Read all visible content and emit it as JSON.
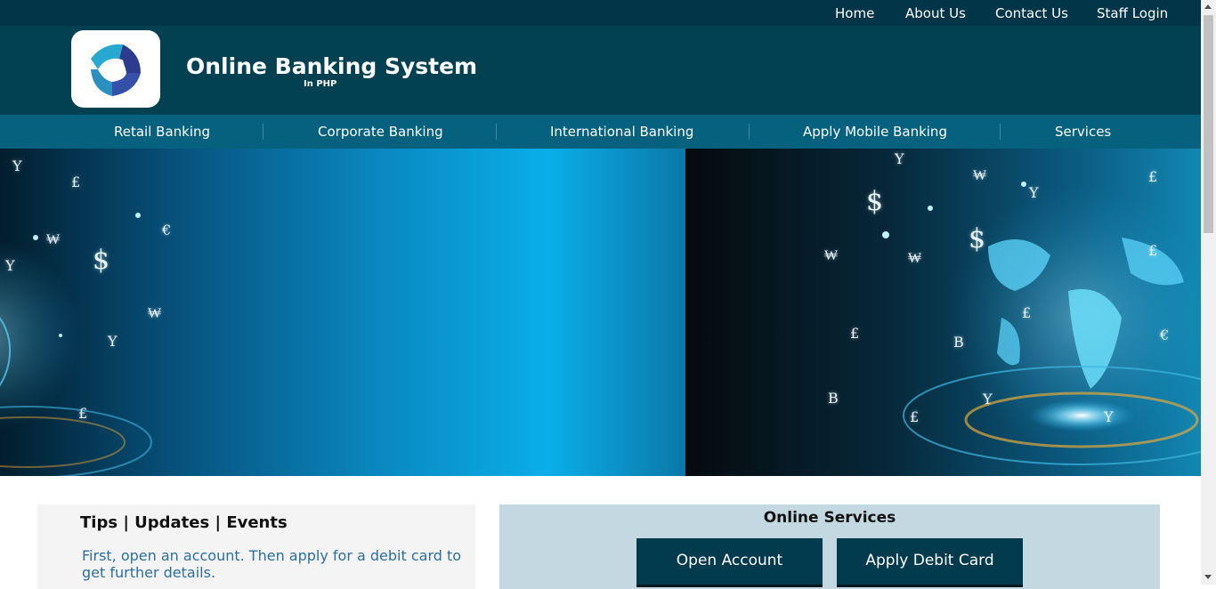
{
  "topnav": {
    "items": [
      {
        "label": "Home"
      },
      {
        "label": "About Us"
      },
      {
        "label": "Contact Us"
      },
      {
        "label": "Staff Login"
      }
    ]
  },
  "header": {
    "title": "Online Banking System",
    "subtitle": "In PHP",
    "logo_icon": "bank-logo-icon"
  },
  "mainnav": {
    "items": [
      {
        "label": "Retail Banking"
      },
      {
        "label": "Corporate Banking"
      },
      {
        "label": "International Banking"
      },
      {
        "label": "Apply Mobile Banking"
      },
      {
        "label": "Services"
      }
    ]
  },
  "banner": {
    "symbols": [
      "Y",
      "£",
      "€",
      "$",
      "₩",
      "Y",
      "₩",
      "Y",
      "£",
      "Y",
      "$",
      "₩",
      "Y",
      "£",
      "₩",
      "₩",
      "$",
      "£",
      "£",
      "B",
      "€",
      "B",
      "Y",
      "£",
      "Y",
      "£"
    ]
  },
  "tips": {
    "title": "Tips | Updates | Events",
    "body": "First, open an account. Then apply for a debit card to get further details."
  },
  "services": {
    "title": "Online Services",
    "open_account_label": "Open Account",
    "apply_debit_label": "Apply Debit Card"
  },
  "colors": {
    "topbar": "#023548",
    "header": "#024152",
    "mainnav": "#05617d",
    "button": "#023b4e",
    "services_panel": "#c3d8e1",
    "tips_text": "#2c6ea1"
  }
}
